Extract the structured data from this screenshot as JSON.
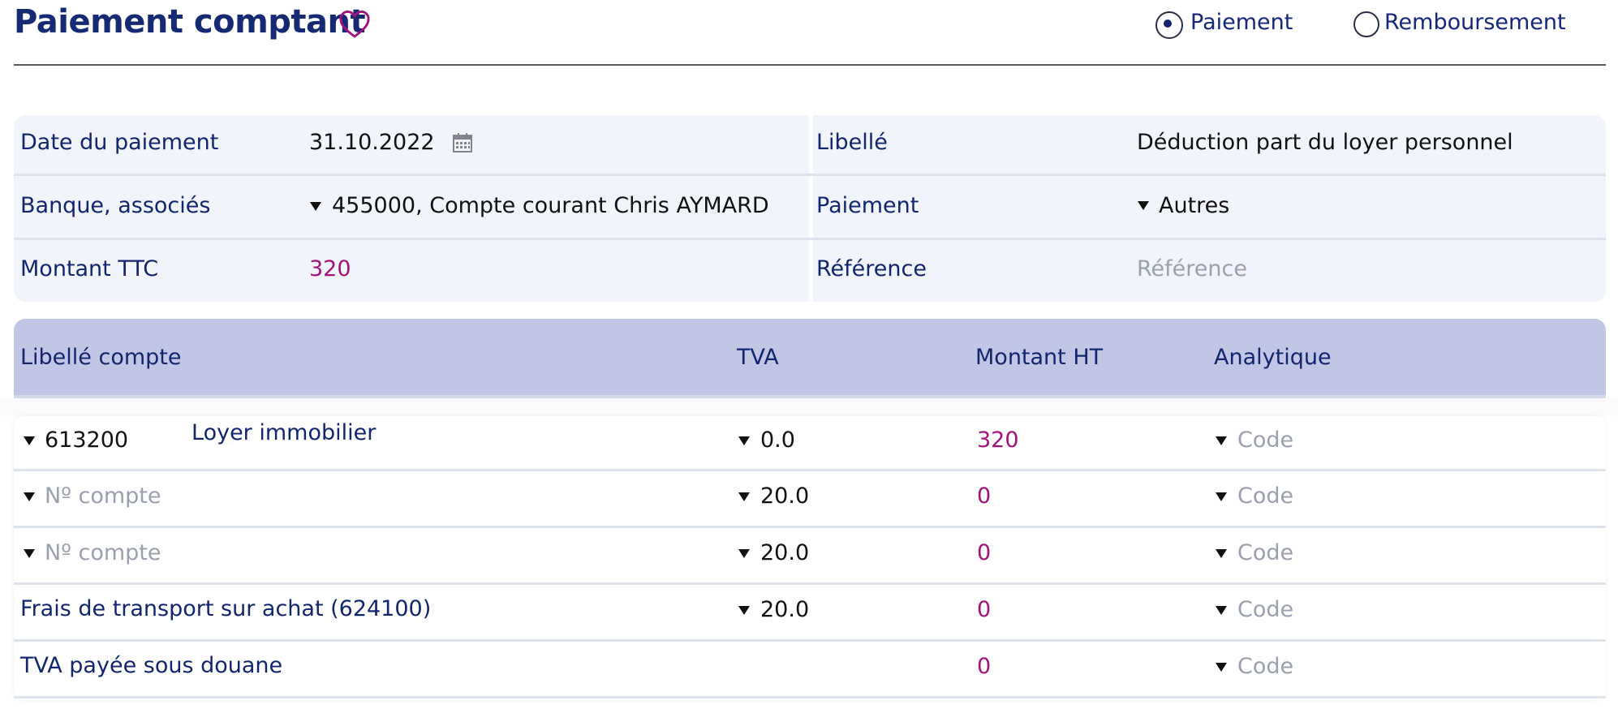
{
  "header": {
    "title": "Paiement comptant",
    "favorite_icon": "heart-icon",
    "radios": [
      {
        "label": "Paiement",
        "selected": true
      },
      {
        "label": "Remboursement",
        "selected": false
      }
    ]
  },
  "form": {
    "date_label": "Date du paiement",
    "date_value": "31.10.2022",
    "calendar_icon": "calendar-icon",
    "bank_label": "Banque, associés",
    "bank_value": "455000, Compte courant Chris AYMARD",
    "amount_label": "Montant TTC",
    "amount_value": "320",
    "libelle_label": "Libellé",
    "libelle_value": "Déduction part du loyer personnel",
    "payment_label": "Paiement",
    "payment_value": "Autres",
    "reference_label": "Référence",
    "reference_placeholder": "Référence"
  },
  "table": {
    "headers": [
      "Libellé compte",
      "TVA",
      "Montant HT",
      "Analytique"
    ],
    "rows": [
      {
        "account": "613200",
        "account_name": "Loyer immobilier",
        "tva": "0.0",
        "amount": "320",
        "analytic_placeholder": "Code"
      },
      {
        "account_placeholder": "Nº compte",
        "tva": "20.0",
        "amount": "0",
        "analytic_placeholder": "Code"
      },
      {
        "account_placeholder": "Nº compte",
        "tva": "20.0",
        "amount": "0",
        "analytic_placeholder": "Code"
      },
      {
        "account_label": "Frais de transport sur achat (624100)",
        "tva": "20.0",
        "amount": "0",
        "analytic_placeholder": "Code"
      },
      {
        "account_label": "TVA payée sous douane",
        "amount": "0",
        "analytic_placeholder": "Code"
      }
    ]
  },
  "colors": {
    "title": "#152a72",
    "accent": "#a3127a",
    "label": "#12256f",
    "table_header_bg": "#c1c6e5",
    "form_bg": "#f1f4fa",
    "placeholder": "#9aa1ae"
  }
}
